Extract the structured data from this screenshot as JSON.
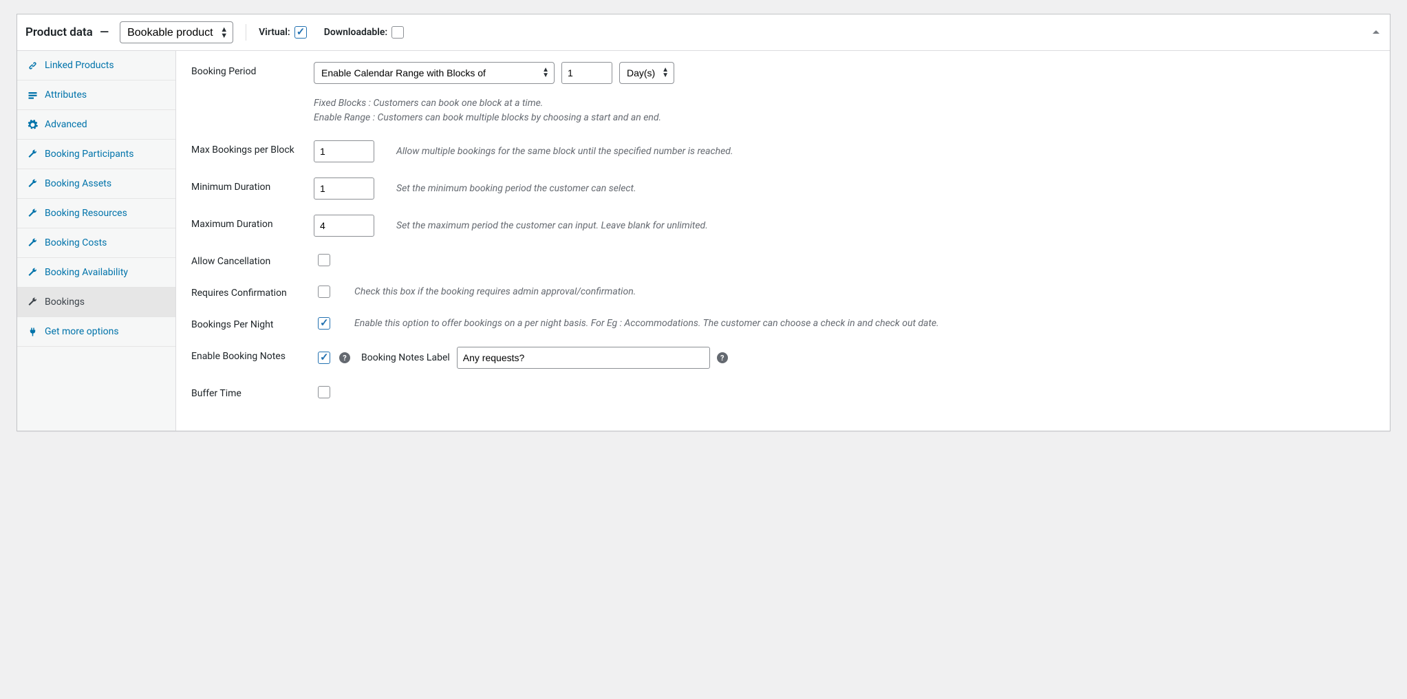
{
  "header": {
    "title": "Product data",
    "dash": "—",
    "type_options": [
      "Bookable product"
    ],
    "type_selected": "Bookable product",
    "virtual_label": "Virtual:",
    "virtual_checked": true,
    "downloadable_label": "Downloadable:",
    "downloadable_checked": false
  },
  "tabs": [
    {
      "icon": "link",
      "label": "Linked Products",
      "active": false
    },
    {
      "icon": "attr",
      "label": "Attributes",
      "active": false
    },
    {
      "icon": "gear",
      "label": "Advanced",
      "active": false
    },
    {
      "icon": "wrench",
      "label": "Booking Participants",
      "active": false
    },
    {
      "icon": "wrench",
      "label": "Booking Assets",
      "active": false
    },
    {
      "icon": "wrench",
      "label": "Booking Resources",
      "active": false
    },
    {
      "icon": "wrench",
      "label": "Booking Costs",
      "active": false
    },
    {
      "icon": "wrench",
      "label": "Booking Availability",
      "active": false
    },
    {
      "icon": "wrench",
      "label": "Bookings",
      "active": true
    },
    {
      "icon": "plug",
      "label": "Get more options",
      "active": false
    }
  ],
  "fields": {
    "booking_period": {
      "label": "Booking Period",
      "select": "Enable Calendar Range with Blocks of",
      "block_count": "1",
      "unit": "Day(s)",
      "help1": "Fixed Blocks : Customers can book one block at a time.",
      "help2": "Enable Range : Customers can book multiple blocks by choosing a start and an end."
    },
    "max_bookings": {
      "label": "Max Bookings per Block",
      "value": "1",
      "desc": "Allow multiple bookings for the same block until the specified number is reached."
    },
    "min_duration": {
      "label": "Minimum Duration",
      "value": "1",
      "desc": "Set the minimum booking period the customer can select."
    },
    "max_duration": {
      "label": "Maximum Duration",
      "value": "4",
      "desc": "Set the maximum period the customer can input. Leave blank for unlimited."
    },
    "allow_cancel": {
      "label": "Allow Cancellation",
      "checked": false
    },
    "requires_conf": {
      "label": "Requires Confirmation",
      "checked": false,
      "desc": "Check this box if the booking requires admin approval/confirmation."
    },
    "per_night": {
      "label": "Bookings Per Night",
      "checked": true,
      "desc": "Enable this option to offer bookings on a per night basis. For Eg : Accommodations. The customer can choose a check in and check out date."
    },
    "enable_notes": {
      "label": "Enable Booking Notes",
      "checked": true,
      "notes_label": "Booking Notes Label",
      "notes_value": "Any requests?"
    },
    "buffer": {
      "label": "Buffer Time",
      "checked": false
    }
  }
}
